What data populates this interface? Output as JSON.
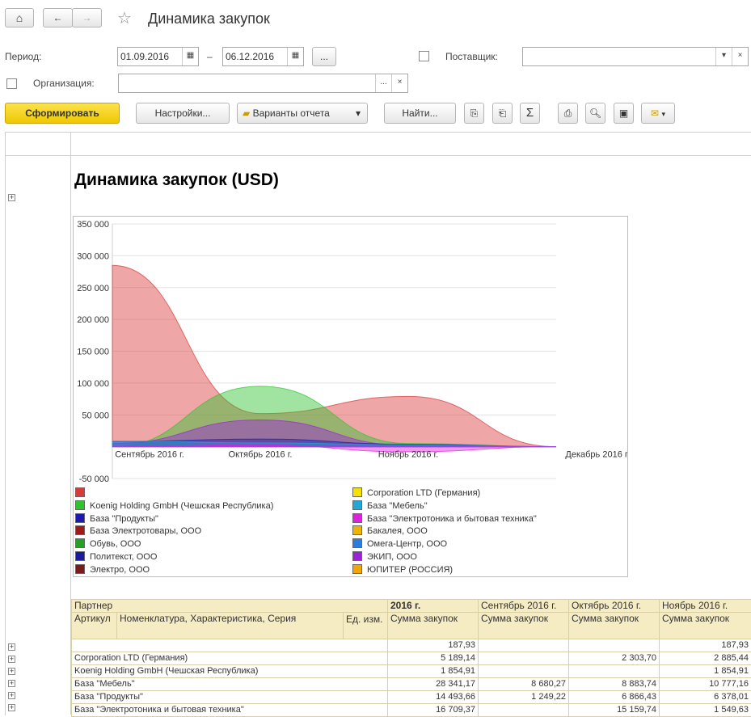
{
  "window": {
    "title": "Динамика закупок"
  },
  "filters": {
    "period_label": "Период:",
    "date_from": "01.09.2016",
    "dash": "–",
    "date_to": "06.12.2016",
    "dots": "...",
    "supplier_label": "Поставщик:",
    "supplier_value": "",
    "org_label": "Организация:",
    "org_value": ""
  },
  "toolbar": {
    "generate": "Сформировать",
    "settings": "Настройки...",
    "variants": "Варианты отчета",
    "find": "Найти..."
  },
  "report": {
    "title": "Динамика закупок (USD)"
  },
  "chart_data": {
    "type": "area",
    "categories": [
      "Сентябрь 2016 г.",
      "Октябрь 2016 г.",
      "Ноябрь 2016 г.",
      "Декабрь 2016 г."
    ],
    "ylim": [
      -50000,
      350000
    ],
    "yticks": [
      "350 000",
      "300 000",
      "250 000",
      "200 000",
      "150 000",
      "100 000",
      "50 000",
      "-50 000"
    ],
    "legend_position": "bottom",
    "series": [
      {
        "name": "",
        "color": "#d93a3a",
        "values": [
          285000,
          52000,
          79000,
          0
        ]
      },
      {
        "name": "Koenig Holding GmbH (Чешская Республика)",
        "color": "#2ec42e",
        "values": [
          0,
          95000,
          5000,
          0
        ]
      },
      {
        "name": "ЭКИП, ООО",
        "color": "#9b22d8",
        "values": [
          5000,
          42000,
          2000,
          0
        ]
      },
      {
        "name": "База \"Продукты\"",
        "color": "#1a1ab0",
        "values": [
          8000,
          12000,
          4000,
          0
        ]
      },
      {
        "name": "База \"Мебель\"",
        "color": "#1fa8d8",
        "values": [
          9000,
          6000,
          3000,
          0
        ]
      },
      {
        "name": "База \"Электротоника и бытовая техника\"",
        "color": "#e020e0",
        "values": [
          0,
          3000,
          -8000,
          0
        ]
      }
    ],
    "legend": [
      {
        "name": "",
        "color": "#d93a3a"
      },
      {
        "name": "Corporation LTD (Германия)",
        "color": "#f5e000"
      },
      {
        "name": "Koenig Holding GmbH (Чешская Республика)",
        "color": "#2ec42e"
      },
      {
        "name": "База \"Мебель\"",
        "color": "#1fa8d8"
      },
      {
        "name": "База \"Продукты\"",
        "color": "#1a1ab0"
      },
      {
        "name": "База \"Электротоника и бытовая техника\"",
        "color": "#e020e0"
      },
      {
        "name": "База Электротовары, ООО",
        "color": "#a01818"
      },
      {
        "name": "Бакалея, ООО",
        "color": "#f0b400"
      },
      {
        "name": "Обувь, ООО",
        "color": "#24a024"
      },
      {
        "name": "Омега-Центр, ООО",
        "color": "#2a7ee0"
      },
      {
        "name": "Политекст, ООО",
        "color": "#1a1a9a"
      },
      {
        "name": "ЭКИП, ООО",
        "color": "#9b22d8"
      },
      {
        "name": "Электро, ООО",
        "color": "#7a1a1a"
      },
      {
        "name": "ЮПИТЕР (РОССИЯ)",
        "color": "#f5a500"
      }
    ]
  },
  "table": {
    "h_partner": "Партнер",
    "h_year": "2016 г.",
    "h_sep": "Сентябрь 2016 г.",
    "h_oct": "Октябрь 2016 г.",
    "h_nov": "Ноябрь 2016 г.",
    "h_article": "Артикул",
    "h_nom": "Номенклатура, Характеристика, Серия",
    "h_unit": "Ед. изм.",
    "h_sum": "Сумма закупок",
    "rows": [
      {
        "name": "",
        "year": "187,93",
        "sep": "",
        "oct": "",
        "nov": "187,93"
      },
      {
        "name": "Corporation LTD (Германия)",
        "year": "5 189,14",
        "sep": "",
        "oct": "2 303,70",
        "nov": "2 885,44"
      },
      {
        "name": "Koenig Holding GmbH (Чешская Республика)",
        "year": "1 854,91",
        "sep": "",
        "oct": "",
        "nov": "1 854,91"
      },
      {
        "name": "База \"Мебель\"",
        "year": "28 341,17",
        "sep": "8 680,27",
        "oct": "8 883,74",
        "nov": "10 777,16"
      },
      {
        "name": "База \"Продукты\"",
        "year": "14 493,66",
        "sep": "1 249,22",
        "oct": "6 866,43",
        "nov": "6 378,01"
      },
      {
        "name": "База \"Электротоника и бытовая техника\"",
        "year": "16 709,37",
        "sep": "",
        "oct": "15 159,74",
        "nov": "1 549,63"
      }
    ]
  }
}
